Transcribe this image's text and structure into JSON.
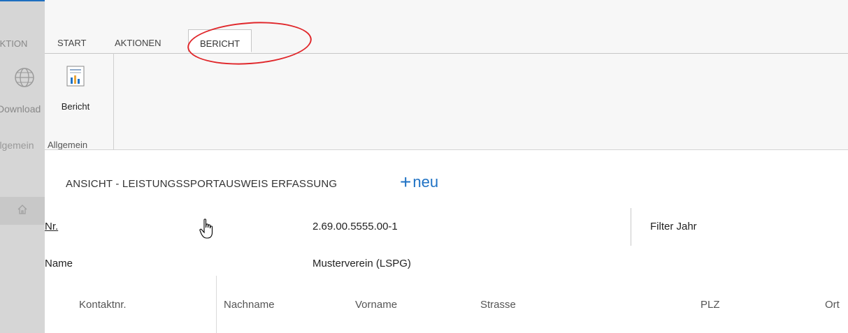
{
  "left_panel": {
    "tab_fragment": "AKTION",
    "download_fragment": "Download",
    "group_fragment": "Allgemein"
  },
  "ribbon": {
    "tabs": [
      {
        "label": "START"
      },
      {
        "label": "AKTIONEN"
      },
      {
        "label": "BERICHT",
        "active": true
      }
    ],
    "report_button_label": "Bericht",
    "group_label": "Allgemein"
  },
  "view": {
    "title": "ANSICHT - LEISTUNGSSPORTAUSWEIS ERFASSUNG",
    "new_label": "neu",
    "new_symbol": "+"
  },
  "record": {
    "nr_label": "Nr.",
    "nr_value": "2.69.00.5555.00-1",
    "name_label": "Name",
    "name_value": "Musterverein (LSPG)",
    "filter_label": "Filter Jahr"
  },
  "table": {
    "columns": [
      "Kontaktnr.",
      "Nachname",
      "Vorname",
      "Strasse",
      "PLZ",
      "Ort"
    ]
  },
  "colors": {
    "accent": "#1f72c4",
    "highlight_circle": "#e0262a",
    "left_panel": "#d6d6d6",
    "ribbon_bg": "#f7f7f7"
  }
}
